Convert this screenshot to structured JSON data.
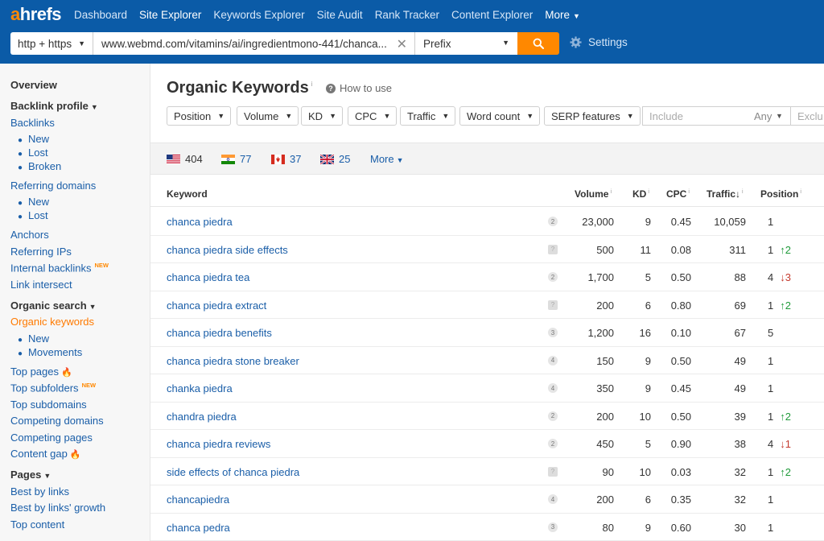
{
  "nav": {
    "logo_a": "a",
    "logo_rest": "hrefs",
    "items": [
      "Dashboard",
      "Site Explorer",
      "Keywords Explorer",
      "Site Audit",
      "Rank Tracker",
      "Content Explorer"
    ],
    "more": "More"
  },
  "search": {
    "protocol": "http + https",
    "url": "www.webmd.com/vitamins/ai/ingredientmono-441/chanca...",
    "mode": "Prefix",
    "settings": "Settings"
  },
  "sidebar": {
    "overview": "Overview",
    "backlink_profile": "Backlink profile",
    "backlinks": "Backlinks",
    "backlinks_sub": [
      "New",
      "Lost",
      "Broken"
    ],
    "referring_domains": "Referring domains",
    "referring_sub": [
      "New",
      "Lost"
    ],
    "anchors": "Anchors",
    "referring_ips": "Referring IPs",
    "internal_backlinks": "Internal backlinks",
    "new_tag": "NEW",
    "link_intersect": "Link intersect",
    "organic_search": "Organic search",
    "organic_keywords": "Organic keywords",
    "organic_sub": [
      "New",
      "Movements"
    ],
    "top_pages": "Top pages",
    "top_subfolders": "Top subfolders",
    "top_subdomains": "Top subdomains",
    "competing_domains": "Competing domains",
    "competing_pages": "Competing pages",
    "content_gap": "Content gap",
    "pages": "Pages",
    "best_by_links": "Best by links",
    "best_by_links_growth": "Best by links' growth",
    "top_content": "Top content"
  },
  "main": {
    "title": "Organic Keywords",
    "title_info": "i",
    "how_to_use": "How to use",
    "filters": [
      "Position",
      "Volume",
      "KD",
      "CPC",
      "Traffic",
      "Word count",
      "SERP features"
    ],
    "include_placeholder": "Include",
    "include_any": "Any",
    "exclude_placeholder": "Exclu",
    "countries": [
      {
        "code": "us",
        "count": "404"
      },
      {
        "code": "in",
        "count": "77"
      },
      {
        "code": "ca",
        "count": "37"
      },
      {
        "code": "gb",
        "count": "25"
      }
    ],
    "countries_more": "More"
  },
  "table": {
    "headers": {
      "keyword": "Keyword",
      "volume": "Volume",
      "kd": "KD",
      "cpc": "CPC",
      "traffic": "Traffic",
      "position": "Position",
      "info": "i",
      "sort_arrow": "↓"
    },
    "rows": [
      {
        "keyword": "chanca piedra",
        "serp": "2",
        "volume": "23,000",
        "kd": "9",
        "cpc": "0.45",
        "traffic": "10,059",
        "position": "1",
        "change": "",
        "dir": ""
      },
      {
        "keyword": "chanca piedra side effects",
        "serp": "?",
        "volume": "500",
        "kd": "11",
        "cpc": "0.08",
        "traffic": "311",
        "position": "1",
        "change": "↑2",
        "dir": "up"
      },
      {
        "keyword": "chanca piedra tea",
        "serp": "2",
        "volume": "1,700",
        "kd": "5",
        "cpc": "0.50",
        "traffic": "88",
        "position": "4",
        "change": "↓3",
        "dir": "down"
      },
      {
        "keyword": "chanca piedra extract",
        "serp": "?",
        "volume": "200",
        "kd": "6",
        "cpc": "0.80",
        "traffic": "69",
        "position": "1",
        "change": "↑2",
        "dir": "up"
      },
      {
        "keyword": "chanca piedra benefits",
        "serp": "3",
        "volume": "1,200",
        "kd": "16",
        "cpc": "0.10",
        "traffic": "67",
        "position": "5",
        "change": "",
        "dir": ""
      },
      {
        "keyword": "chanca piedra stone breaker",
        "serp": "4",
        "volume": "150",
        "kd": "9",
        "cpc": "0.50",
        "traffic": "49",
        "position": "1",
        "change": "",
        "dir": ""
      },
      {
        "keyword": "chanka piedra",
        "serp": "4",
        "volume": "350",
        "kd": "9",
        "cpc": "0.45",
        "traffic": "49",
        "position": "1",
        "change": "",
        "dir": ""
      },
      {
        "keyword": "chandra piedra",
        "serp": "2",
        "volume": "200",
        "kd": "10",
        "cpc": "0.50",
        "traffic": "39",
        "position": "1",
        "change": "↑2",
        "dir": "up"
      },
      {
        "keyword": "chanca piedra reviews",
        "serp": "2",
        "volume": "450",
        "kd": "5",
        "cpc": "0.90",
        "traffic": "38",
        "position": "4",
        "change": "↓1",
        "dir": "down"
      },
      {
        "keyword": "side effects of chanca piedra",
        "serp": "?",
        "volume": "90",
        "kd": "10",
        "cpc": "0.03",
        "traffic": "32",
        "position": "1",
        "change": "↑2",
        "dir": "up"
      },
      {
        "keyword": "chancapiedra",
        "serp": "4",
        "volume": "200",
        "kd": "6",
        "cpc": "0.35",
        "traffic": "32",
        "position": "1",
        "change": "",
        "dir": ""
      },
      {
        "keyword": "chanca pedra",
        "serp": "3",
        "volume": "80",
        "kd": "9",
        "cpc": "0.60",
        "traffic": "30",
        "position": "1",
        "change": "",
        "dir": ""
      }
    ]
  },
  "colors": {
    "nav_bg": "#0b5ba7",
    "accent": "#ff8800",
    "link": "#1a5ea8",
    "up": "#1f9a3a",
    "down": "#c43a2e"
  }
}
